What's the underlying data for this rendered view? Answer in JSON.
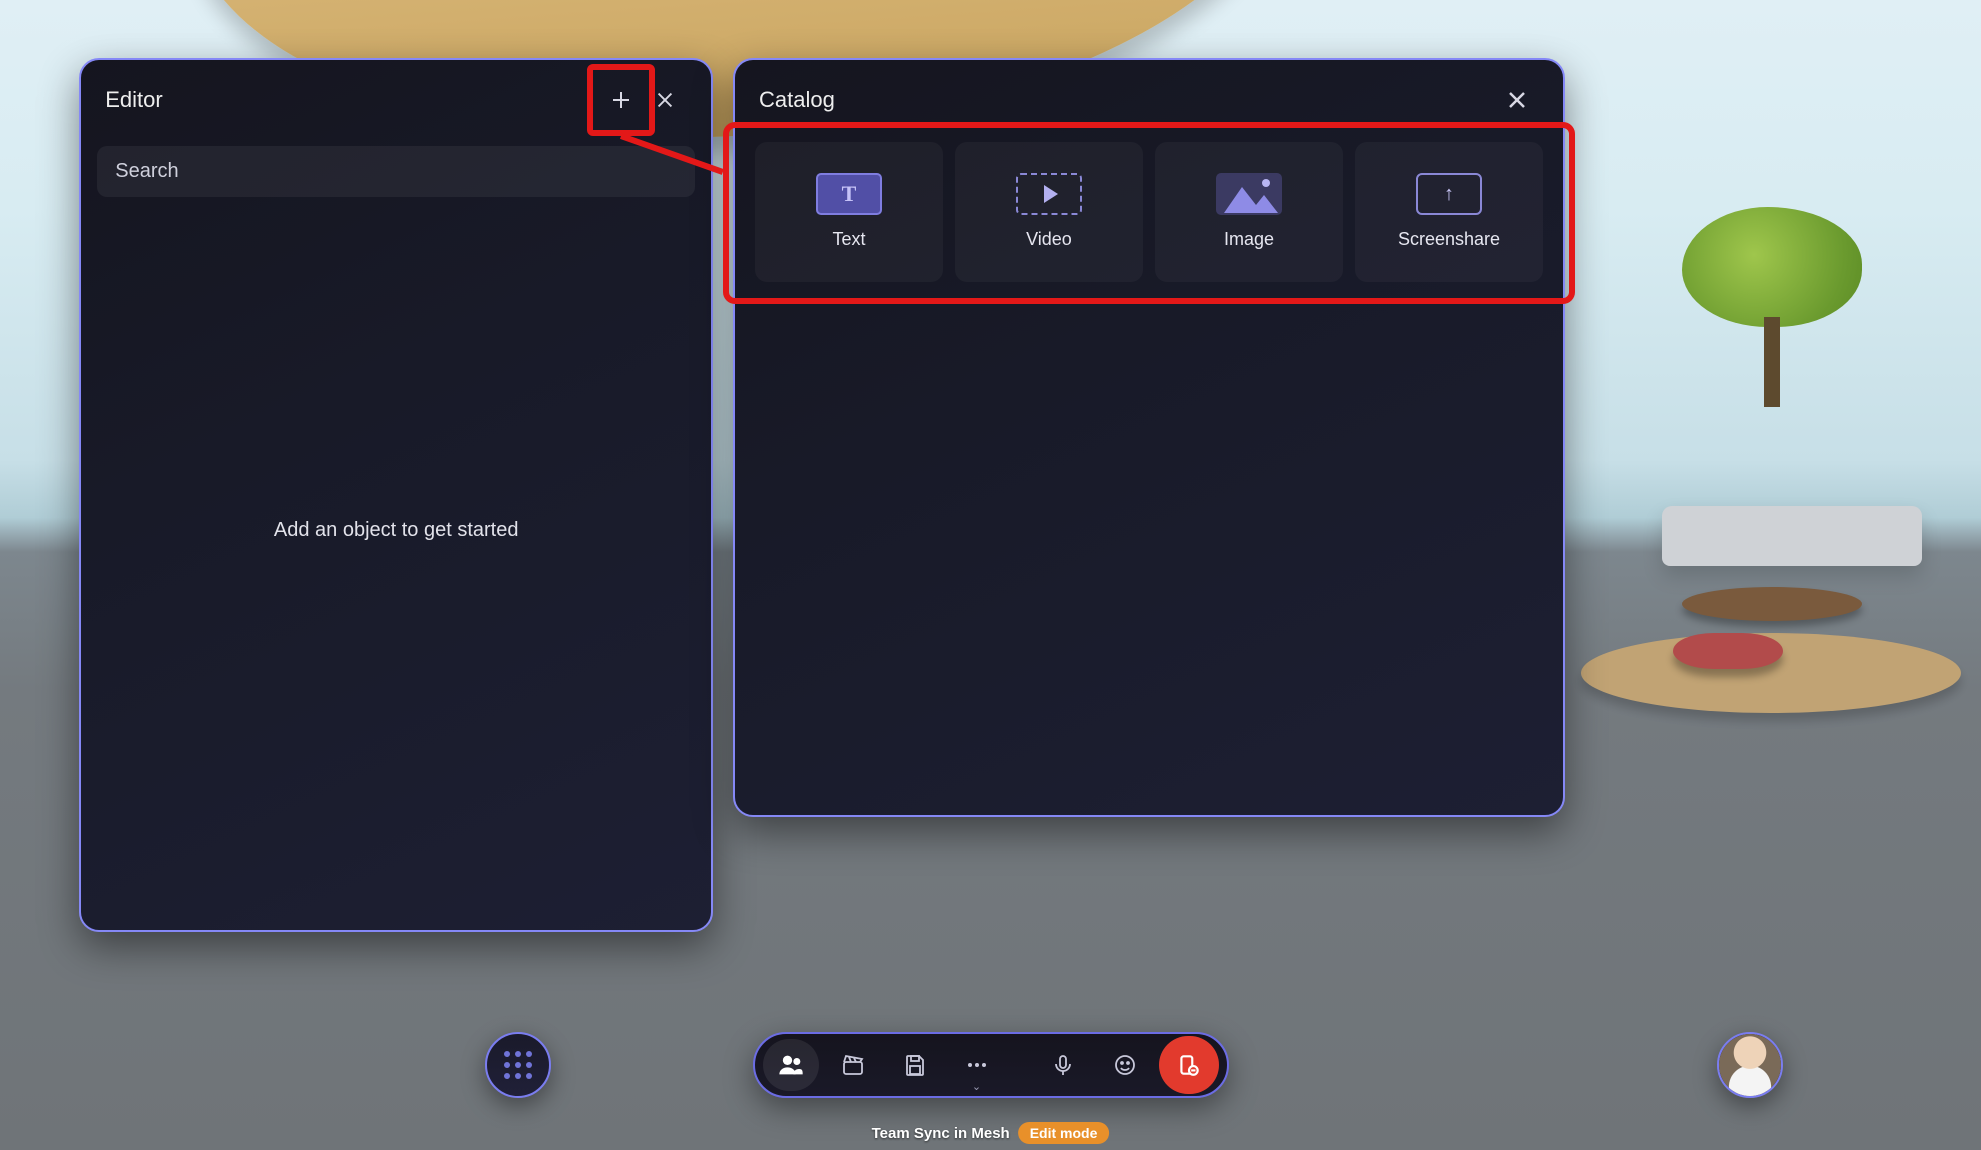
{
  "editor": {
    "title": "Editor",
    "search_placeholder": "Search",
    "empty_message": "Add an object to get started"
  },
  "catalog": {
    "title": "Catalog",
    "items": [
      {
        "label": "Text"
      },
      {
        "label": "Video"
      },
      {
        "label": "Image"
      },
      {
        "label": "Screenshare"
      }
    ]
  },
  "status": {
    "session": "Team Sync in Mesh",
    "mode": "Edit mode"
  },
  "colors": {
    "panel_border": "#8588f6",
    "highlight": "#e31818",
    "accent": "#e8902a"
  }
}
